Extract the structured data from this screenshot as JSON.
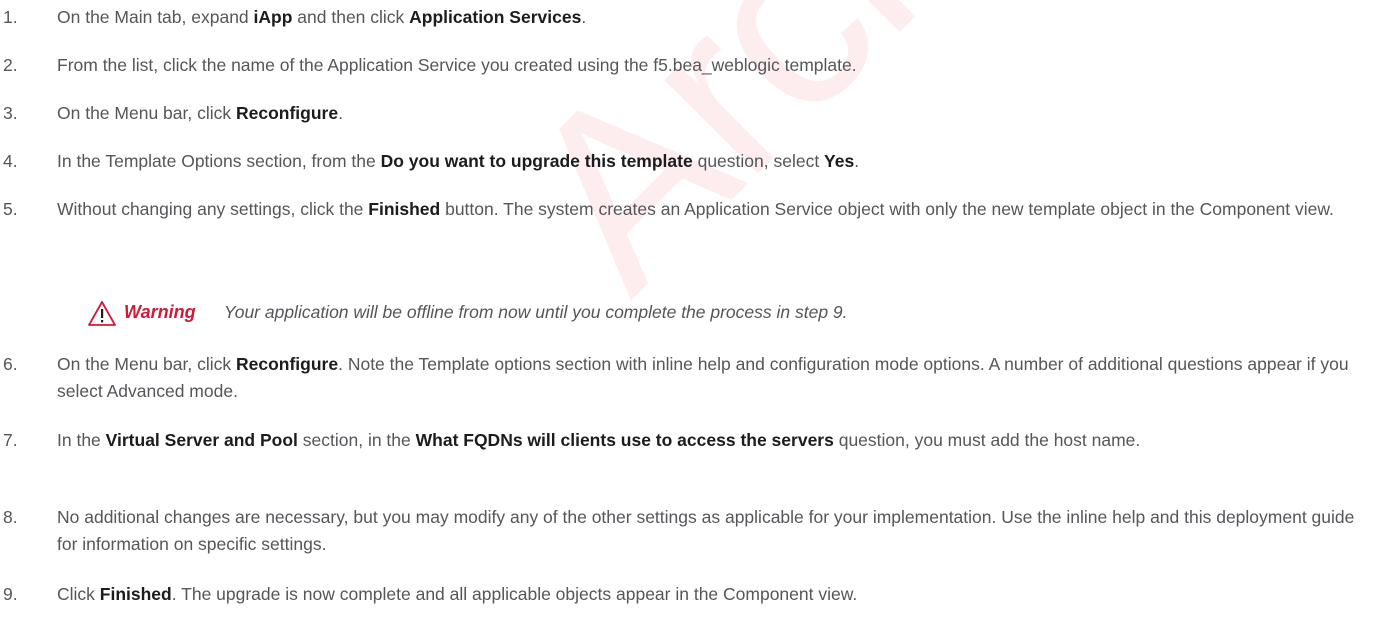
{
  "watermark": "Archived",
  "warning": {
    "icon": "warning-triangle-icon",
    "label": "Warning",
    "text": "Your application will be offline from now until you complete the process in step 9."
  },
  "steps": [
    {
      "num": "1.",
      "parts": [
        {
          "t": "On the Main tab, expand "
        },
        {
          "t": "iApp",
          "b": true
        },
        {
          "t": " and then click "
        },
        {
          "t": "Application Services",
          "b": true
        },
        {
          "t": "."
        }
      ]
    },
    {
      "num": "2.",
      "parts": [
        {
          "t": "From the list, click the name of the Application Service you created using the f5.bea_weblogic template."
        }
      ]
    },
    {
      "num": "3.",
      "parts": [
        {
          "t": "On the Menu bar, click "
        },
        {
          "t": "Reconfigure",
          "b": true
        },
        {
          "t": "."
        }
      ]
    },
    {
      "num": "4.",
      "parts": [
        {
          "t": "In the Template Options section, from the "
        },
        {
          "t": "Do you want to upgrade this template",
          "b": true
        },
        {
          "t": " question, select "
        },
        {
          "t": "Yes",
          "b": true
        },
        {
          "t": "."
        }
      ]
    },
    {
      "num": "5.",
      "parts": [
        {
          "t": "Without changing any settings, click the "
        },
        {
          "t": "Finished",
          "b": true
        },
        {
          "t": " button.  The system creates an Application Service object with only the new template object in the Component view."
        }
      ]
    },
    {
      "num": "6.",
      "parts": [
        {
          "t": "On the Menu bar, click "
        },
        {
          "t": "Reconfigure",
          "b": true
        },
        {
          "t": ".  Note the Template options section with inline help and configuration mode options.  A number of additional questions appear if you select Advanced mode."
        }
      ]
    },
    {
      "num": "7.",
      "parts": [
        {
          "t": "In the "
        },
        {
          "t": "Virtual Server and Pool",
          "b": true
        },
        {
          "t": " section, in the "
        },
        {
          "t": "What FQDNs will clients use to access the servers",
          "b": true
        },
        {
          "t": " question, you must add the host name."
        }
      ]
    },
    {
      "num": "8.",
      "parts": [
        {
          "t": "No additional changes are necessary, but you may modify any of the other settings as applicable for your implementation.  Use the inline help and this deployment guide for information on specific settings."
        }
      ]
    },
    {
      "num": "9.",
      "parts": [
        {
          "t": "Click "
        },
        {
          "t": "Finished",
          "b": true
        },
        {
          "t": ".  The upgrade is now complete and all applicable objects appear in the Component view."
        }
      ]
    }
  ]
}
